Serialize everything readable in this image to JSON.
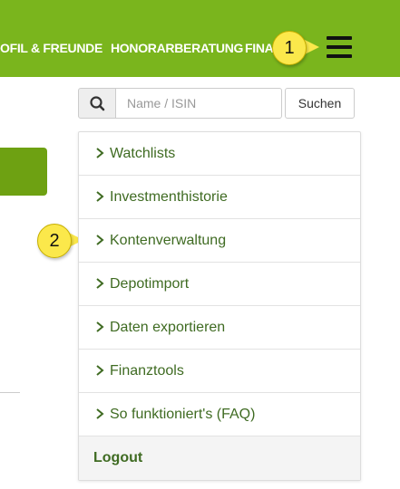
{
  "topnav": {
    "items": [
      {
        "label": "OFIL & FREUNDE"
      },
      {
        "label": "HONORARBERATUNG"
      },
      {
        "label": "FINANZ"
      }
    ],
    "background": "#7ab51d"
  },
  "callouts": {
    "one": "1",
    "two": "2",
    "color": "#fbe84b"
  },
  "search": {
    "placeholder": "Name / ISIN",
    "button_label": "Suchen"
  },
  "menu": {
    "items": [
      {
        "label": "Watchlists"
      },
      {
        "label": "Investmenthistorie"
      },
      {
        "label": "Kontenverwaltung"
      },
      {
        "label": "Depotimport"
      },
      {
        "label": "Daten exportieren"
      },
      {
        "label": "Finanztools"
      },
      {
        "label": "So funktioniert's (FAQ)"
      }
    ],
    "logout_label": "Logout",
    "link_color": "#3f6b22"
  }
}
